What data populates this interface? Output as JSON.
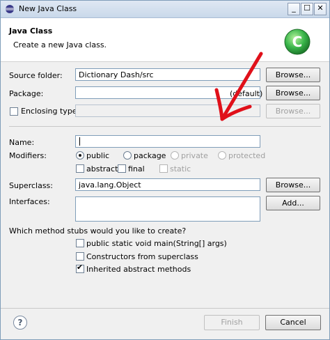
{
  "window": {
    "title": "New Java Class",
    "controls": {
      "minimize": "_",
      "maximize": "☐",
      "close": "✕"
    }
  },
  "header": {
    "title": "Java Class",
    "subtitle": "Create a new Java class.",
    "logo_letter": "C"
  },
  "form": {
    "source_folder": {
      "label": "Source folder:",
      "value": "Dictionary Dash/src",
      "button": "Browse..."
    },
    "package": {
      "label": "Package:",
      "value": "",
      "hint": "(default)",
      "button": "Browse..."
    },
    "enclosing_type": {
      "label": "Enclosing type:",
      "checked": false,
      "value": "",
      "button": "Browse..."
    },
    "name": {
      "label": "Name:",
      "value": ""
    },
    "modifiers": {
      "label": "Modifiers:",
      "public": "public",
      "package": "package",
      "private": "private",
      "protected": "protected",
      "abstract": "abstract",
      "final": "final",
      "static": "static",
      "selected": "public"
    },
    "superclass": {
      "label": "Superclass:",
      "value": "java.lang.Object",
      "button": "Browse..."
    },
    "interfaces": {
      "label": "Interfaces:",
      "button": "Add..."
    },
    "stubs": {
      "question": "Which method stubs would you like to create?",
      "main": {
        "label": "public static void main(String[] args)",
        "checked": false
      },
      "constructors": {
        "label": "Constructors from superclass",
        "checked": false
      },
      "inherited": {
        "label": "Inherited abstract methods",
        "checked": true
      }
    }
  },
  "footer": {
    "help": "?",
    "finish": "Finish",
    "cancel": "Cancel"
  },
  "colors": {
    "annotation_arrow": "#e0101a",
    "logo_green": "#39b54a"
  }
}
